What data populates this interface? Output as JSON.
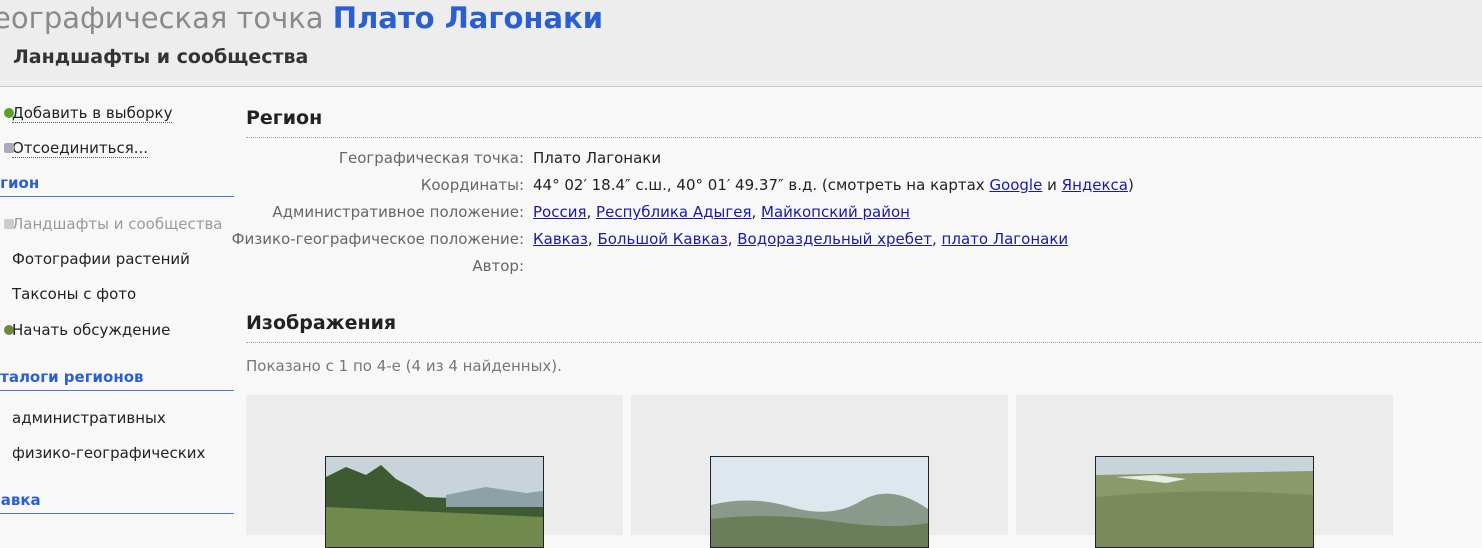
{
  "header": {
    "title_prefix": "еографическая точка",
    "title_place": "Плато Лагонаки",
    "subtitle": "Ландшафты и сообщества"
  },
  "sidebar": {
    "actions": [
      {
        "label": "Добавить в выборку",
        "icon": "green-dot-icon"
      },
      {
        "label": "Отсоединиться...",
        "icon": "disconnect-icon"
      }
    ],
    "region_heading": "егион",
    "region_items": [
      {
        "label": "Ландшафты и сообщества",
        "active": true
      },
      {
        "label": "Фотографии растений"
      },
      {
        "label": "Таксоны с фото"
      },
      {
        "label": "Начать обсуждение",
        "icon": "discussion-icon"
      }
    ],
    "catalogs_heading": "аталоги регионов",
    "catalog_items": [
      {
        "label": "административных"
      },
      {
        "label": "физико-географических"
      }
    ],
    "help_heading": "равка"
  },
  "region": {
    "title": "Регион",
    "rows": {
      "point_label": "Географическая точка:",
      "point_value": "Плато Лагонаки",
      "coords_label": "Координаты:",
      "coords_text": "44° 02′ 18.4″ с.ш., 40° 01′ 49.37″ в.д. (смотреть на картах",
      "coords_google": "Google",
      "coords_and": "и",
      "coords_yandex": "Яндекса",
      "coords_close": ")",
      "admin_label": "Административное положение:",
      "admin_links": [
        "Россия",
        "Республика Адыгея",
        "Майкопский район"
      ],
      "phys_label": "Физико-географическое положение:",
      "phys_links": [
        "Кавказ",
        "Большой Кавказ",
        "Водораздельный хребет",
        "плато Лагонаки"
      ],
      "author_label": "Автор:"
    }
  },
  "images": {
    "title": "Изображения",
    "shown_text": "Показано с 1 по 4-е (4 из 4 найденных).",
    "thumbnails": [
      "forest-meadow-photo",
      "mountain-valley-photo",
      "plateau-photo"
    ]
  },
  "colors": {
    "accent": "#2a5fd0",
    "link": "#1a1aa6",
    "muted": "#9a9a9a"
  }
}
